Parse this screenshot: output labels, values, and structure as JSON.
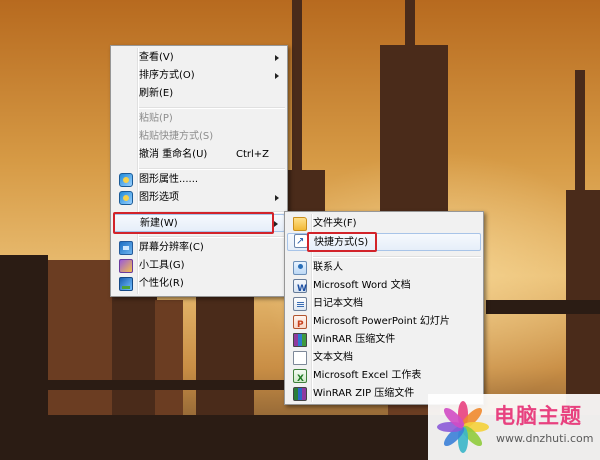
{
  "context_menu": {
    "items": [
      {
        "label": "查看(V)",
        "shortcut": "",
        "submenu": true,
        "disabled": false,
        "icon": ""
      },
      {
        "label": "排序方式(O)",
        "shortcut": "",
        "submenu": true,
        "disabled": false,
        "icon": ""
      },
      {
        "label": "刷新(E)",
        "shortcut": "",
        "submenu": false,
        "disabled": false,
        "icon": ""
      },
      {
        "label": "粘贴(P)",
        "shortcut": "",
        "submenu": false,
        "disabled": true,
        "icon": ""
      },
      {
        "label": "粘贴快捷方式(S)",
        "shortcut": "",
        "submenu": false,
        "disabled": true,
        "icon": ""
      },
      {
        "label": "撤消 重命名(U)",
        "shortcut": "Ctrl+Z",
        "submenu": false,
        "disabled": false,
        "icon": ""
      },
      {
        "label": "图形属性......",
        "shortcut": "",
        "submenu": false,
        "disabled": false,
        "icon": "graphics-icon"
      },
      {
        "label": "图形选项",
        "shortcut": "",
        "submenu": true,
        "disabled": false,
        "icon": "graphics-icon"
      },
      {
        "label": "新建(W)",
        "shortcut": "",
        "submenu": true,
        "disabled": false,
        "icon": "",
        "highlighted": true
      },
      {
        "label": "屏幕分辨率(C)",
        "shortcut": "",
        "submenu": false,
        "disabled": false,
        "icon": "display-icon"
      },
      {
        "label": "小工具(G)",
        "shortcut": "",
        "submenu": false,
        "disabled": false,
        "icon": "gadget-icon"
      },
      {
        "label": "个性化(R)",
        "shortcut": "",
        "submenu": false,
        "disabled": false,
        "icon": "personalize-icon"
      }
    ]
  },
  "new_submenu": {
    "items": [
      {
        "label": "文件夹(F)",
        "icon": "folder-icon"
      },
      {
        "label": "快捷方式(S)",
        "icon": "shortcut-icon",
        "highlighted": true
      },
      {
        "label": "联系人",
        "icon": "contact-icon"
      },
      {
        "label": "Microsoft Word 文档",
        "icon": "word-doc-icon"
      },
      {
        "label": "日记本文档",
        "icon": "journal-icon"
      },
      {
        "label": "Microsoft PowerPoint 幻灯片",
        "icon": "powerpoint-icon"
      },
      {
        "label": "WinRAR 压缩文件",
        "icon": "winrar-icon"
      },
      {
        "label": "文本文档",
        "icon": "text-doc-icon"
      },
      {
        "label": "Microsoft Excel 工作表",
        "icon": "excel-icon"
      },
      {
        "label": "WinRAR ZIP 压缩文件",
        "icon": "winrar-zip-icon"
      }
    ]
  },
  "watermark": {
    "title": "电脑主题",
    "url": "www.dnzhuti.com"
  },
  "colors": {
    "highlight_border": "#d2232a",
    "menu_bg": "#f1f1f1",
    "watermark_pink": "#e8417f"
  }
}
